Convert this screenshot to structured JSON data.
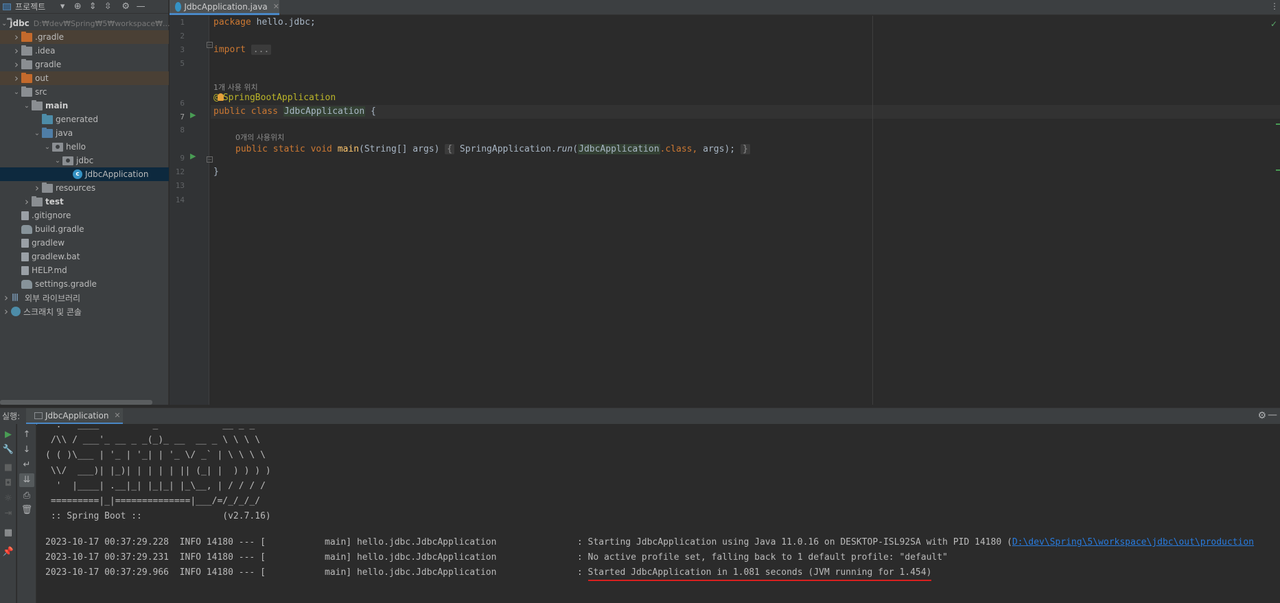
{
  "project_panel": {
    "title": "프로젝트",
    "tree": [
      {
        "label": "jdbc",
        "hint": "D:₩dev₩Spring₩5₩workspace₩...",
        "indent": 0,
        "arrow": "v",
        "icon": "folder",
        "bold": true
      },
      {
        "label": ".gradle",
        "indent": 1,
        "arrow": ">",
        "icon": "folder-orange",
        "excluded": true
      },
      {
        "label": ".idea",
        "indent": 1,
        "arrow": ">",
        "icon": "folder"
      },
      {
        "label": "gradle",
        "indent": 1,
        "arrow": ">",
        "icon": "folder"
      },
      {
        "label": "out",
        "indent": 1,
        "arrow": ">",
        "icon": "folder-orange",
        "excluded": true
      },
      {
        "label": "src",
        "indent": 1,
        "arrow": "v",
        "icon": "folder"
      },
      {
        "label": "main",
        "indent": 2,
        "arrow": "v",
        "icon": "folder",
        "bold": true
      },
      {
        "label": "generated",
        "indent": 3,
        "arrow": "",
        "icon": "folder-teal"
      },
      {
        "label": "java",
        "indent": 3,
        "arrow": "v",
        "icon": "folder-blue"
      },
      {
        "label": "hello",
        "indent": 4,
        "arrow": "v",
        "icon": "package"
      },
      {
        "label": "jdbc",
        "indent": 5,
        "arrow": "v",
        "icon": "package"
      },
      {
        "label": "JdbcApplication",
        "indent": 6,
        "arrow": "",
        "icon": "java-class",
        "selected": true
      },
      {
        "label": "resources",
        "indent": 3,
        "arrow": ">",
        "icon": "folder"
      },
      {
        "label": "test",
        "indent": 2,
        "arrow": ">",
        "icon": "folder",
        "bold": true
      },
      {
        "label": ".gitignore",
        "indent": 1,
        "arrow": "",
        "icon": "file"
      },
      {
        "label": "build.gradle",
        "indent": 1,
        "arrow": "",
        "icon": "gradle-file"
      },
      {
        "label": "gradlew",
        "indent": 1,
        "arrow": "",
        "icon": "file"
      },
      {
        "label": "gradlew.bat",
        "indent": 1,
        "arrow": "",
        "icon": "file"
      },
      {
        "label": "HELP.md",
        "indent": 1,
        "arrow": "",
        "icon": "file"
      },
      {
        "label": "settings.gradle",
        "indent": 1,
        "arrow": "",
        "icon": "gradle-file"
      },
      {
        "label": "외부 라이브러리",
        "indent": 0,
        "arrow": ">",
        "icon": "library"
      },
      {
        "label": "스크래치 및 콘솔",
        "indent": 0,
        "arrow": ">",
        "icon": "scratch"
      }
    ]
  },
  "editor": {
    "tab_label": "JdbcApplication.java",
    "line_numbers": [
      "1",
      "2",
      "3",
      "5",
      "6",
      "7",
      "8",
      "9",
      "12",
      "13",
      "14"
    ],
    "hints": {
      "usage_class": "1개 사용 위치",
      "usage_main": "0개의 사용위치"
    },
    "code": {
      "l1_kw": "package",
      "l1_rest": " hello.jdbc;",
      "l3_kw": "import",
      "l3_folded": "...",
      "l6_at": "@",
      "l6_ann": "SpringBootApplication",
      "l7_kw": "public class ",
      "l7_cls": "JdbcApplication",
      "l7_rest": " {",
      "l9_kw": "public static void ",
      "l9_fn": "main",
      "l9_params": "(String[] args)",
      "l9_open": "{",
      "l9_body1": " SpringApplication.",
      "l9_run": "run",
      "l9_paren": "(",
      "l9_cls": "JdbcApplication",
      "l9_dotclass": ".class,",
      "l9_args": " args);",
      "l9_close": "}",
      "l13": "}"
    }
  },
  "run_panel": {
    "label": "실행:",
    "tab_label": "JdbcApplication",
    "banner": [
      "  .   ____          _            __ _ _",
      " /\\\\ / ___'_ __ _ _(_)_ __  __ _ \\ \\ \\ \\",
      "( ( )\\___ | '_ | '_| | '_ \\/ _` | \\ \\ \\ \\",
      " \\\\/  ___)| |_)| | | | | || (_| |  ) ) ) )",
      "  '  |____| .__|_| |_|_| |_\\__, | / / / /",
      " =========|_|==============|___/=/_/_/_/",
      " :: Spring Boot ::               (v2.7.16)"
    ],
    "log": [
      {
        "prefix": "2023-10-17 00:37:29.228  INFO 14180 --- [           main] hello.jdbc.JdbcApplication               : ",
        "message": "Starting JdbcApplication using Java 11.0.16 on DESKTOP-ISL92SA with PID 14180 (",
        "link": "D:\\dev\\Spring\\5\\workspace\\jdbc\\out\\production"
      },
      {
        "prefix": "2023-10-17 00:37:29.231  INFO 14180 --- [           main] hello.jdbc.JdbcApplication               : ",
        "message": "No active profile set, falling back to 1 default profile: \"default\"",
        "link": ""
      },
      {
        "prefix": "2023-10-17 00:37:29.966  INFO 14180 --- [           main] hello.jdbc.JdbcApplication               : ",
        "message": "Started JdbcApplication in 1.081 seconds (JVM running for 1.454)",
        "link": ""
      }
    ]
  },
  "colors": {
    "accent": "#4a88c7",
    "keyword": "#cc7832",
    "annotation": "#bbb529",
    "function": "#ffc66d",
    "run_green": "#499c54",
    "underline_red": "#d9201f"
  }
}
